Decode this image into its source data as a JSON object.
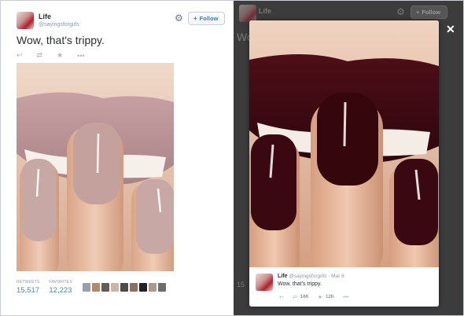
{
  "tweet": {
    "author_name": "Life",
    "author_handle": "@sayingsforgirls",
    "follow_label": "Follow",
    "text": "Wow, that's trippy.",
    "stats": [
      {
        "label": "RETWEETS",
        "value": "15,517"
      },
      {
        "label": "FAVORITES",
        "value": "12,223"
      }
    ]
  },
  "overlay": {
    "bg_name": "Life",
    "bg_follow_label": "Follow",
    "bg_text_fragment": "Wo",
    "bg_numbers_fragment": "15",
    "close_glyph": "✕",
    "modal": {
      "name": "Life",
      "handle_and_date": "@sayingsforgirls · Mar 6",
      "text": "Wow, that's trippy.",
      "retweet_count": "16K",
      "favorite_count": "12K"
    }
  },
  "icons": {
    "reply": "↩",
    "retweet": "⇄",
    "favorite": "★",
    "more": "•••",
    "gear": "⚙",
    "follow": "👤"
  },
  "colors": {
    "link_blue": "#4e86b8",
    "follow_blue": "#3a7bbf",
    "nail_pink": "#c8a8a4",
    "nail_burgundy": "#3a0810"
  }
}
